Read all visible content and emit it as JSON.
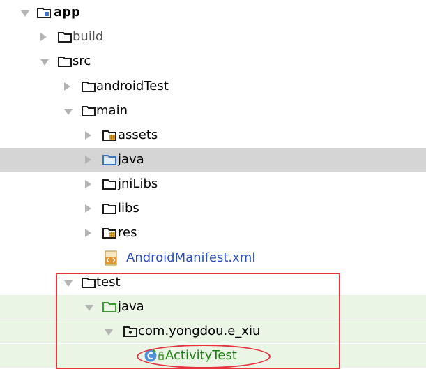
{
  "tree": {
    "items": [
      {
        "label": "app",
        "state": "expanded",
        "icon": "module-folder-icon",
        "style": "bold"
      },
      {
        "label": "build",
        "state": "collapsed",
        "icon": "folder-icon",
        "style": "muted"
      },
      {
        "label": "src",
        "state": "expanded",
        "icon": "folder-icon",
        "style": "normal"
      },
      {
        "label": "androidTest",
        "state": "collapsed",
        "icon": "folder-icon",
        "style": "normal"
      },
      {
        "label": "main",
        "state": "expanded",
        "icon": "folder-icon",
        "style": "normal"
      },
      {
        "label": "assets",
        "state": "collapsed",
        "icon": "resource-folder-icon",
        "style": "normal"
      },
      {
        "label": "java",
        "state": "collapsed",
        "icon": "source-folder-icon",
        "style": "normal",
        "selected": true
      },
      {
        "label": "jniLibs",
        "state": "collapsed",
        "icon": "folder-icon",
        "style": "normal"
      },
      {
        "label": "libs",
        "state": "collapsed",
        "icon": "folder-icon",
        "style": "normal"
      },
      {
        "label": "res",
        "state": "collapsed",
        "icon": "resource-folder-icon",
        "style": "normal"
      },
      {
        "label": "AndroidManifest.xml",
        "state": "leaf",
        "icon": "xml-file-icon",
        "style": "blue"
      },
      {
        "label": "test",
        "state": "expanded",
        "icon": "folder-icon",
        "style": "normal"
      },
      {
        "label": "java",
        "state": "expanded",
        "icon": "test-source-folder-icon",
        "style": "normal",
        "tinted": true
      },
      {
        "label": "com.yongdou.e_xiu",
        "state": "expanded",
        "icon": "package-icon",
        "style": "normal",
        "tinted": true
      },
      {
        "label": "ActivityTest",
        "state": "leaf",
        "icon": "test-class-icon",
        "style": "green",
        "tinted": true
      }
    ]
  },
  "colors": {
    "selection": "#d5d5d5",
    "test_tint": "#eaf5e6",
    "highlight_red": "#e8323c",
    "folder_blue": "#3a73c4",
    "test_green": "#4caf3a"
  }
}
